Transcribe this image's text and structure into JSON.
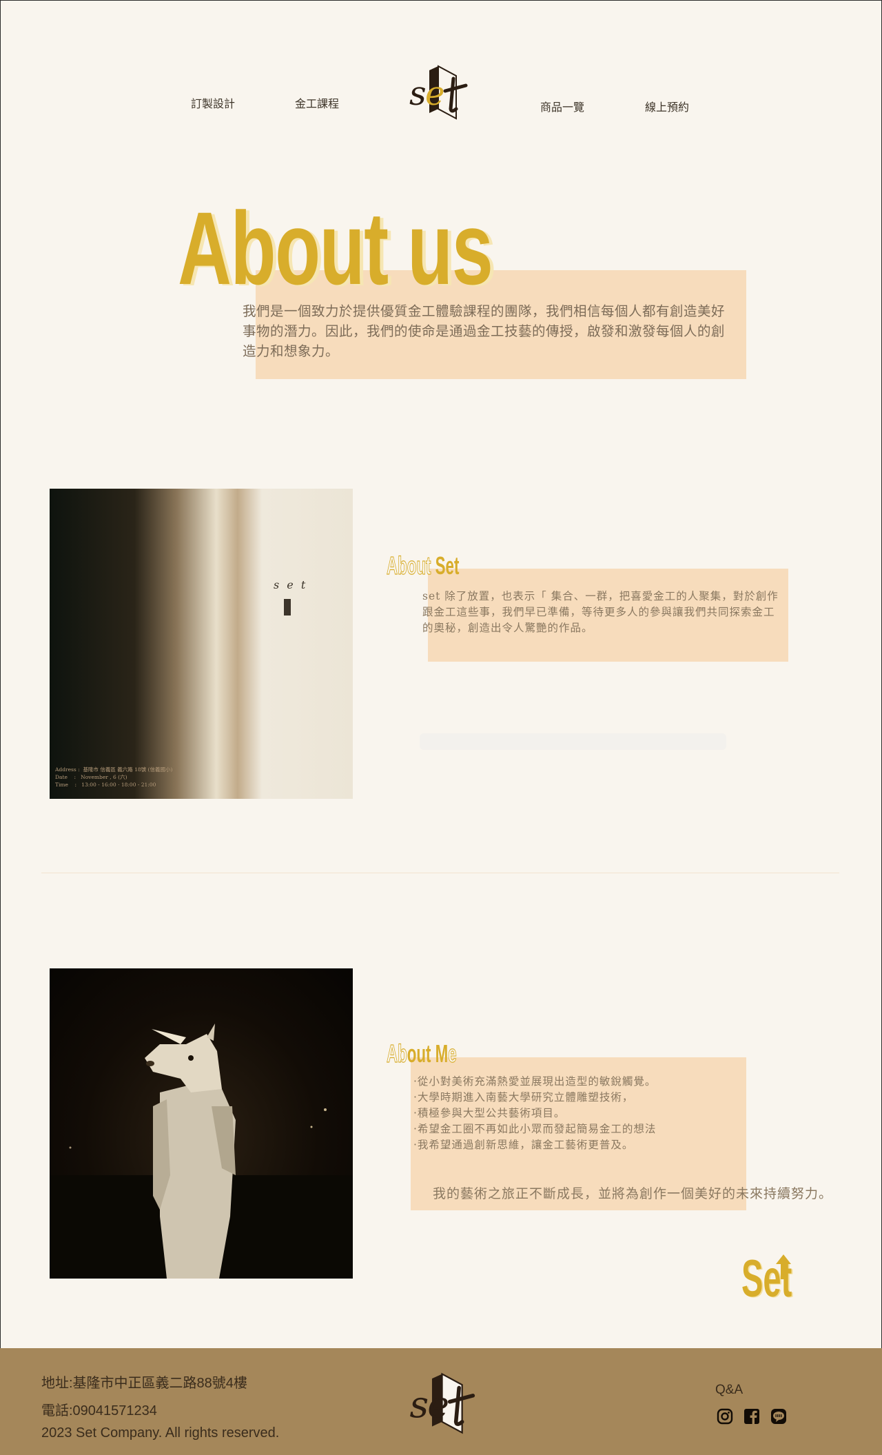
{
  "nav": {
    "items": [
      {
        "label": "訂製設計"
      },
      {
        "label": "金工課程"
      },
      {
        "label": "商品一覽"
      },
      {
        "label": "線上預約"
      }
    ],
    "logo_text": "set"
  },
  "about_us": {
    "title": "About us",
    "text": "我們是一個致力於提供優質金工體驗課程的團隊，我們相信每個人都有創造美好事物的潛力。因此，我們的使命是通過金工技藝的傳授，啟發和激發每個人的創造力和想象力。"
  },
  "about_set": {
    "title_a": "About",
    "title_b": "Set",
    "text": "set 除了放置，也表示「 集合、一群，把喜愛金工的人聚集，對於創作跟金工這些事，我們早已準備，等待更多人的參與讓我們共同探索金工的奧秘，創造出令人驚艷的作品。",
    "poster": {
      "brand": "s e t",
      "address_label": "Address :",
      "address": "基隆市 信義區 義六路 18號 (信義國小)",
      "date_label": "Date",
      "date": "November , 6 (六)",
      "time_label": "Time",
      "time": "13:00 - 16:00   ·   18:00 - 21:00"
    }
  },
  "about_me": {
    "title_a": "Ab",
    "title_b": "out M",
    "title_c": "e",
    "items": [
      "·從小對美術充滿熱愛並展現出造型的敏銳觸覺。",
      "·大學時期進入南藝大學研究立體雕塑技術，",
      "·積極參與大型公共藝術項目。",
      "·希望金工圈不再如此小眾而發起簡易金工的想法",
      "·我希望通過創新思維，讓金工藝術更普及。"
    ],
    "quote": "我的藝術之旅正不斷成長，並將為創作一個美好的未來持續努力。"
  },
  "brand_mark": "Set",
  "footer": {
    "address": "地址:基隆市中正區義二路88號4樓",
    "phone": "電話:09041571234",
    "copyright": "2023 Set Company. All rights reserved.",
    "qa": "Q&A",
    "social_icons": [
      "instagram-icon",
      "facebook-icon",
      "line-icon"
    ]
  },
  "colors": {
    "background": "#f9f5ee",
    "accent": "#d8ad2b",
    "peach": "#f7dcbc",
    "footer": "#a5875a"
  }
}
